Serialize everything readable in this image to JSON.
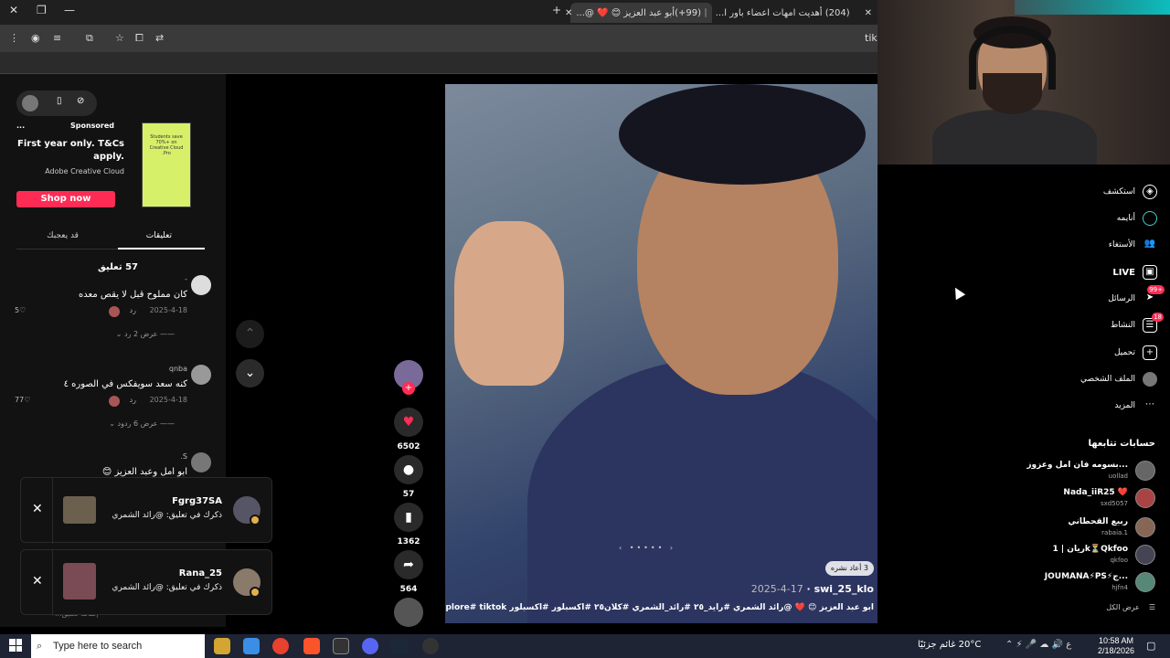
{
  "browser": {
    "window_controls": {
      "close": "✕",
      "restore": "❐",
      "minimize": "—"
    },
    "tabs": [
      {
        "title": "(99+)أبو عبد العزيز 😊 ❤️ @...",
        "active": true
      },
      {
        "title": "(204) أهديت امهات اعضاء باور ا...",
        "active": false
      }
    ],
    "new_tab": "+",
    "address_partial": "tikt"
  },
  "left_panel": {
    "ad": {
      "sponsored": "Sponsored",
      "more": "...",
      "headline": "First year only. T&Cs apply.",
      "brand": "Adobe Creative Cloud",
      "thumb_text": "Students save 70%+ on Creative Cloud Pro.",
      "cta": "Shop now"
    },
    "tabs": {
      "comments": "تعليقات",
      "you_may_like": "قد يعجبك"
    },
    "comments_count": "57 تعليق",
    "comments": [
      {
        "user": "-",
        "text": "كان مملوح قبل لا يقص معده",
        "date": "2025-4-18",
        "reply": "رد",
        "likes": "5",
        "more": "عرض 2 رد"
      },
      {
        "user": "qnba",
        "text": "كنه سعد سويفكس في الصوره ٤",
        "date": "2025-4-18",
        "reply": "رد",
        "likes": "77",
        "more": "عرض 6 ردود"
      },
      {
        "user": "S.",
        "text": "ابو امل وعبد العزيز 😊"
      }
    ],
    "reply_input": {
      "placeholder": "إضافة تعليق..."
    }
  },
  "notifications": [
    {
      "user": "Fgrg37SA",
      "message": "ذكرك في تعليق: @رائد الشمري"
    },
    {
      "user": "Rana_25",
      "message": "ذكرك في تعليق: @رائد الشمري"
    }
  ],
  "actions": {
    "likes": "6502",
    "comments": "57",
    "saves": "1362",
    "shares": "564"
  },
  "video": {
    "username": "swi_25_klo",
    "date": "2025-4-17",
    "caption": "ابو عبد العزيز 😊 ❤️ @رائد الشمري #رايد_٢٥ #رائد_الشمري #كلان٢٥ #اكسبلور #اكسبلور explore# tiktok#",
    "repost": "3 أعاد نشره"
  },
  "right_nav": {
    "items": [
      {
        "label": "استكشف",
        "icon": "compass-icon"
      },
      {
        "label": "أنايمه",
        "icon": "circle-icon"
      },
      {
        "label": "الأستغاء",
        "icon": "people-icon"
      },
      {
        "label": "LIVE",
        "icon": "live-icon"
      },
      {
        "label": "الرسائل",
        "icon": "message-icon",
        "badge": "99+"
      },
      {
        "label": "النشاط",
        "icon": "activity-icon",
        "badge": "18"
      },
      {
        "label": "تحميل",
        "icon": "upload-icon"
      },
      {
        "label": "الملف الشخصي",
        "icon": "profile-icon"
      },
      {
        "label": "المزيد",
        "icon": "more-icon"
      }
    ],
    "following_title": "حسابات تتابعها",
    "following": [
      {
        "name": "بسومه فان امل وعزوز...",
        "handle": "uollad"
      },
      {
        "name": "Nada_iiR25 ❤️",
        "handle": "sxd5057"
      },
      {
        "name": "ربيع القحطاني",
        "handle": "rabaia.1"
      },
      {
        "name": "ريان | 1k⏳Qkfoo",
        "handle": "qkfoo"
      },
      {
        "name": "JOUMANA⚡PS⚡ج...",
        "handle": "hjfn4"
      }
    ],
    "see_all": "عرض الكل"
  },
  "taskbar": {
    "search_placeholder": "Type here to search",
    "weather": "20°C  غائم جزئيًا",
    "lang": "ع",
    "time": "10:58 AM",
    "date": "2/18/2026"
  }
}
